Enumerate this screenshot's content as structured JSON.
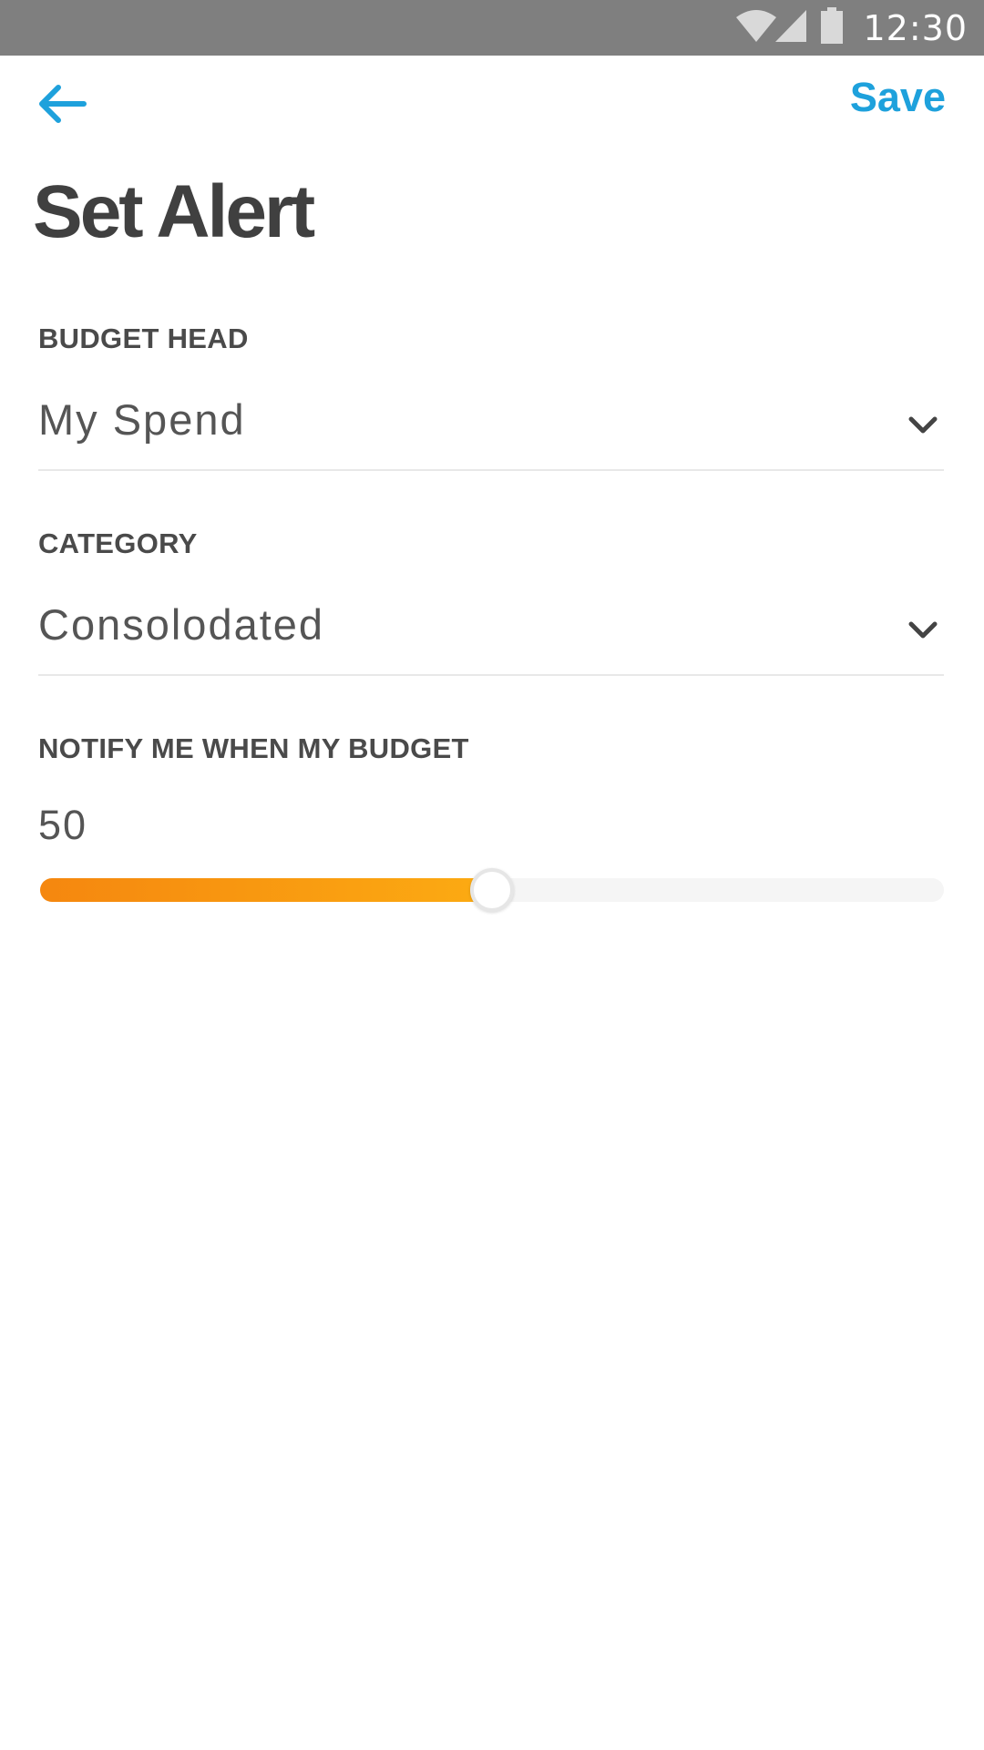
{
  "status_bar": {
    "time": "12:30",
    "icons": [
      "wifi-icon",
      "cell-signal-icon",
      "battery-icon"
    ],
    "background": "#7f7f7f"
  },
  "toolbar": {
    "back_icon": "arrow-left-icon",
    "save_label": "Save",
    "accent_color": "#1ea1dc"
  },
  "page": {
    "title": "Set Alert"
  },
  "form": {
    "budget_head": {
      "label": "BUDGET HEAD",
      "value": "My Spend",
      "icon": "chevron-down-icon"
    },
    "category": {
      "label": "CATEGORY",
      "value": "Consolodated",
      "icon": "chevron-down-icon"
    },
    "notify": {
      "label": "NOTIFY ME WHEN MY BUDGET",
      "value": "50",
      "slider_percent": 50,
      "fill_colors": [
        "#f5870f",
        "#fcab12"
      ]
    }
  }
}
